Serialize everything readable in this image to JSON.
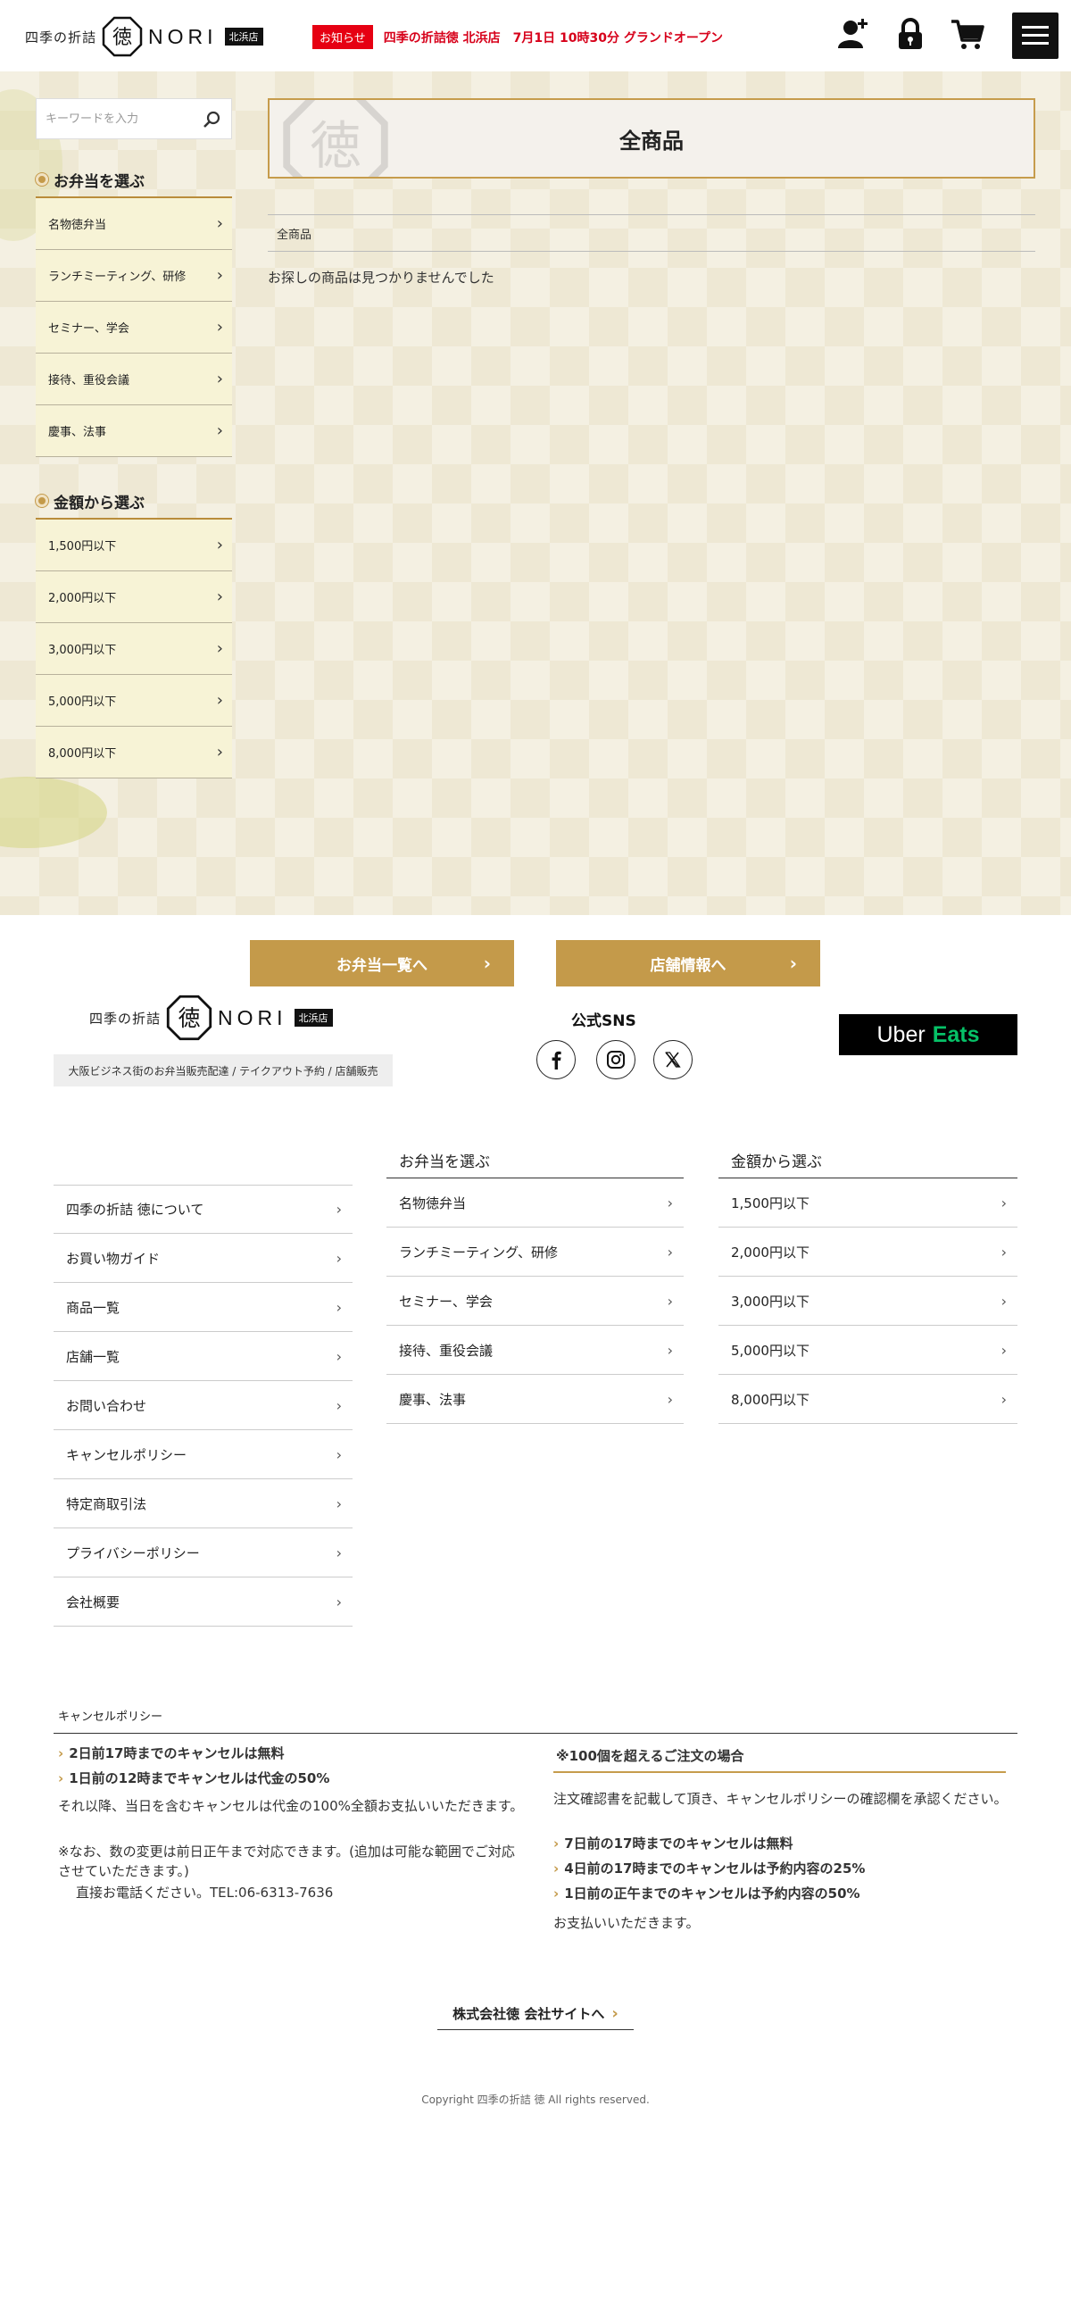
{
  "header": {
    "logo_small": "四季の折詰",
    "logo_seal": "徳",
    "logo_nori": "NORI",
    "logo_branch": "北浜店",
    "notice_badge": "お知らせ",
    "notice_text": "四季の折詰徳 北浜店　7月1日 10時30分 グランドオープン",
    "icons": [
      "user-add-icon",
      "lock-icon",
      "cart-icon",
      "hamburger-menu-icon"
    ]
  },
  "search": {
    "placeholder": "キーワードを入力"
  },
  "sidebar": {
    "bento": {
      "title": "お弁当を選ぶ",
      "items": [
        "名物徳弁当",
        "ランチミーティング、研修",
        "セミナー、学会",
        "接待、重役会議",
        "慶事、法事"
      ]
    },
    "price": {
      "title": "金額から選ぶ",
      "items": [
        "1,500円以下",
        "2,000円以下",
        "3,000円以下",
        "5,000円以下",
        "8,000円以下"
      ]
    }
  },
  "main": {
    "category_title": "全商品",
    "breadcrumb": "全商品",
    "empty_message": "お探しの商品は見つかりませんでした"
  },
  "cta": {
    "bento_list": "お弁当一覧へ",
    "shop_info": "店舗情報へ"
  },
  "footer": {
    "tagline": "大阪ビジネス街のお弁当販売配達 / テイクアウト予約 / 店舗販売",
    "sns_title": "公式SNS",
    "sns_icons": [
      "facebook-icon",
      "instagram-icon",
      "x-icon"
    ],
    "uber": {
      "part1": "Uber",
      "part2": "Eats"
    },
    "links": [
      "四季の折詰 徳について",
      "お買い物ガイド",
      "商品一覧",
      "店舗一覧",
      "お問い合わせ",
      "キャンセルポリシー",
      "特定商取引法",
      "プライバシーポリシー",
      "会社概要"
    ],
    "bento_title": "お弁当を選ぶ",
    "bento_items": [
      "名物徳弁当",
      "ランチミーティング、研修",
      "セミナー、学会",
      "接待、重役会議",
      "慶事、法事"
    ],
    "price_title": "金額から選ぶ",
    "price_items": [
      "1,500円以下",
      "2,000円以下",
      "3,000円以下",
      "5,000円以下",
      "8,000円以下"
    ]
  },
  "cancel": {
    "title": "キャンセルポリシー",
    "left_rule1": "2日前17時までのキャンセルは無料",
    "left_rule2": "1日前の12時までキャンセルは代金の50%",
    "left_text1": "それ以降、当日を含むキャンセルは代金の100%全額お支払いいただきます。",
    "left_text2": "※なお、数の変更は前日正午まで対応できます。(追加は可能な範囲でご対応させていただきます。)",
    "left_text3": "直接お電話ください。TEL:06-6313-7636",
    "right_title": "※100個を超えるご注文の場合",
    "right_text1": "注文確認書を記載して頂き、キャンセルポリシーの確認欄を承認ください。",
    "right_rule1": "7日前の17時までのキャンセルは無料",
    "right_rule2": "4日前の17時までのキャンセルは予約内容の25%",
    "right_rule3": "1日前の正午までのキャンセルは予約内容の50%",
    "right_text2": "お支払いいただきます。"
  },
  "company_link": "株式会社徳 会社サイトへ",
  "copyright": "Copyright 四季の折詰 徳 All rights reserved."
}
